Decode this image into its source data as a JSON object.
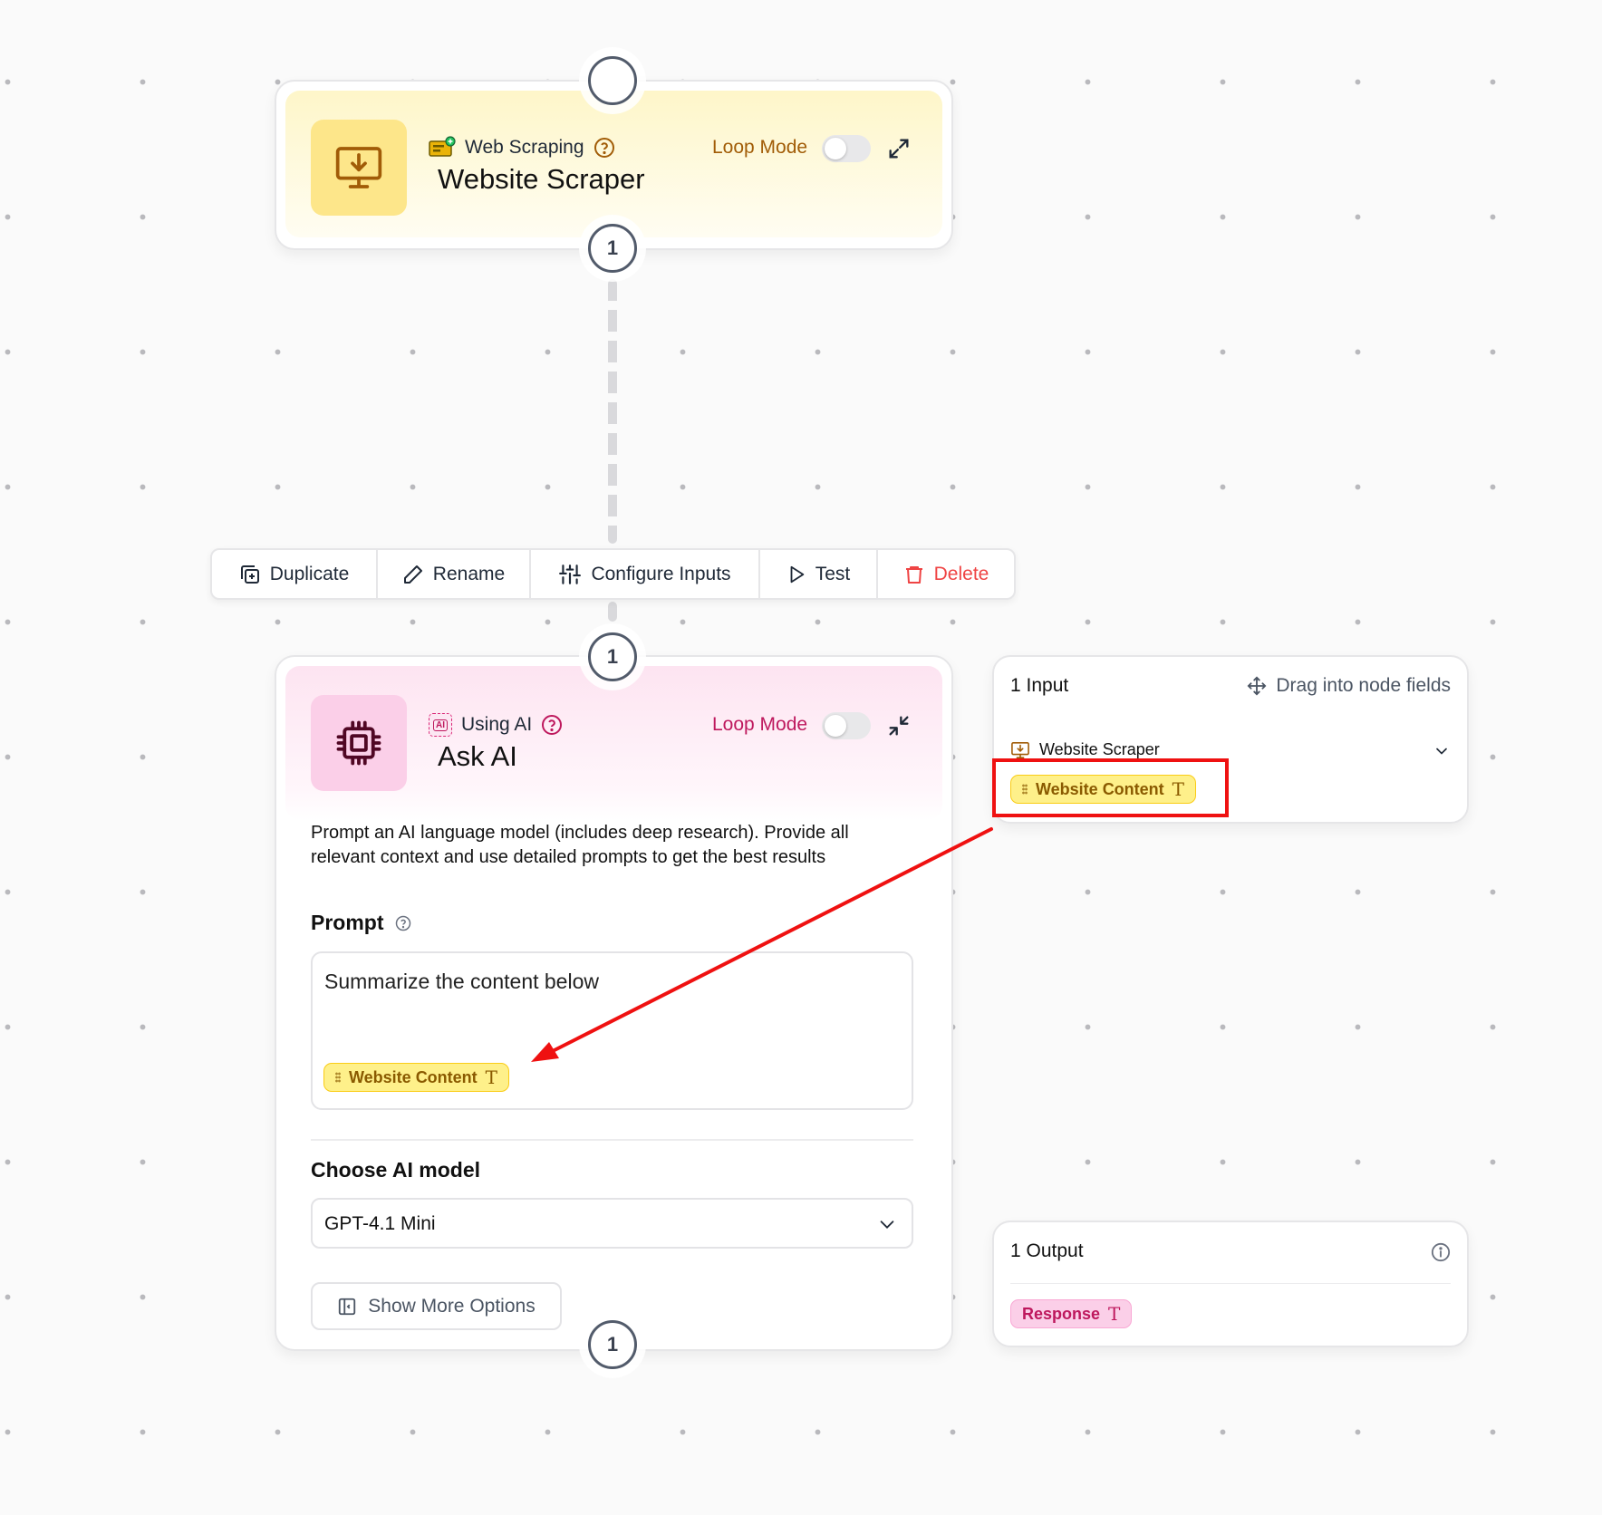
{
  "scraper_node": {
    "category": "Web Scraping",
    "title": "Website Scraper",
    "loop_mode_label": "Loop Mode",
    "loop_mode_on": false,
    "output_port": "1"
  },
  "toolbar": {
    "duplicate": "Duplicate",
    "rename": "Rename",
    "configure_inputs": "Configure Inputs",
    "test": "Test",
    "delete": "Delete"
  },
  "ai_node": {
    "input_port": "1",
    "category": "Using AI",
    "category_badge": "AI",
    "title": "Ask AI",
    "loop_mode_label": "Loop Mode",
    "loop_mode_on": false,
    "description": "Prompt an AI language model (includes deep research). Provide all relevant context and use detailed prompts to get the best results",
    "prompt_label": "Prompt",
    "prompt_text": "Summarize the content below",
    "prompt_variable": "Website Content",
    "model_label": "Choose AI model",
    "model_value": "GPT-4.1 Mini",
    "more_options": "Show More Options",
    "output_port": "1"
  },
  "inputs_panel": {
    "title": "1 Input",
    "hint": "Drag into node fields",
    "source": "Website Scraper",
    "variable": "Website Content"
  },
  "outputs_panel": {
    "title": "1 Output",
    "variable": "Response"
  },
  "colors": {
    "scraper_accent": "#b45309",
    "ai_accent": "#be185d",
    "delete": "#ef4444",
    "annotation": "#ef1111"
  }
}
